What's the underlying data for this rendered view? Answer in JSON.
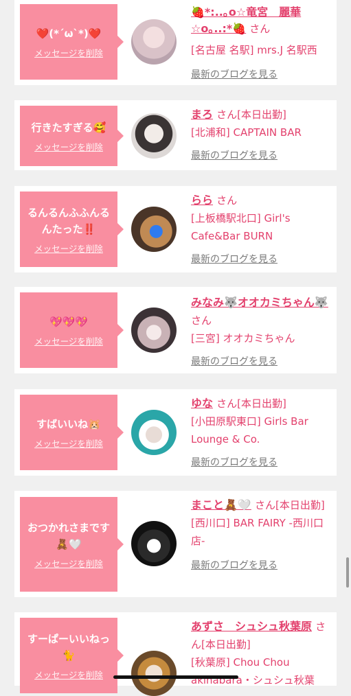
{
  "labels": {
    "delete": "メッセージを削除",
    "blog": "最新のブログを見る",
    "san": "さん"
  },
  "cards": [
    {
      "message": "❤️(*´ω`*)❤️",
      "name": "🍓*:..｡o☆竜宮　麗華☆o｡..:*🍓",
      "line1_rest": "",
      "shop": "[名古屋 名駅] mrs.J 名駅西"
    },
    {
      "message": "行きたすぎる🥰",
      "name": "まろ",
      "line1_rest": "[本日出勤]",
      "shop": "[北浦和] CAPTAIN BAR"
    },
    {
      "message": "るんるんふふんるんたった‼️",
      "name": "らら",
      "line1_rest": "",
      "shop": "[上板橋駅北口] Girl's Cafe&Bar BURN"
    },
    {
      "message": "💖💖💖",
      "name": "みなみ🐺オオカミちゃん🐺",
      "line1_rest": "",
      "shop": "[三宮] オオカミちゃん"
    },
    {
      "message": "すばいいね🐹",
      "name": "ゆな",
      "line1_rest": "[本日出勤]",
      "shop": "[小田原駅東口] Girls Bar Lounge & Co."
    },
    {
      "message": "おつかれさまです🧸🤍",
      "name": "まこと🧸🤍",
      "line1_rest": "[本日出勤]",
      "shop": "[西川口] BAR FAIRY -西川口店-"
    },
    {
      "message": "すーぱーいいねっ🐈",
      "name": "あずさ　シュシュ秋葉原",
      "line1_rest": "[本日出勤]",
      "shop": "[秋葉原] Chou Chou akihabara・シュシュ秋葉"
    }
  ]
}
